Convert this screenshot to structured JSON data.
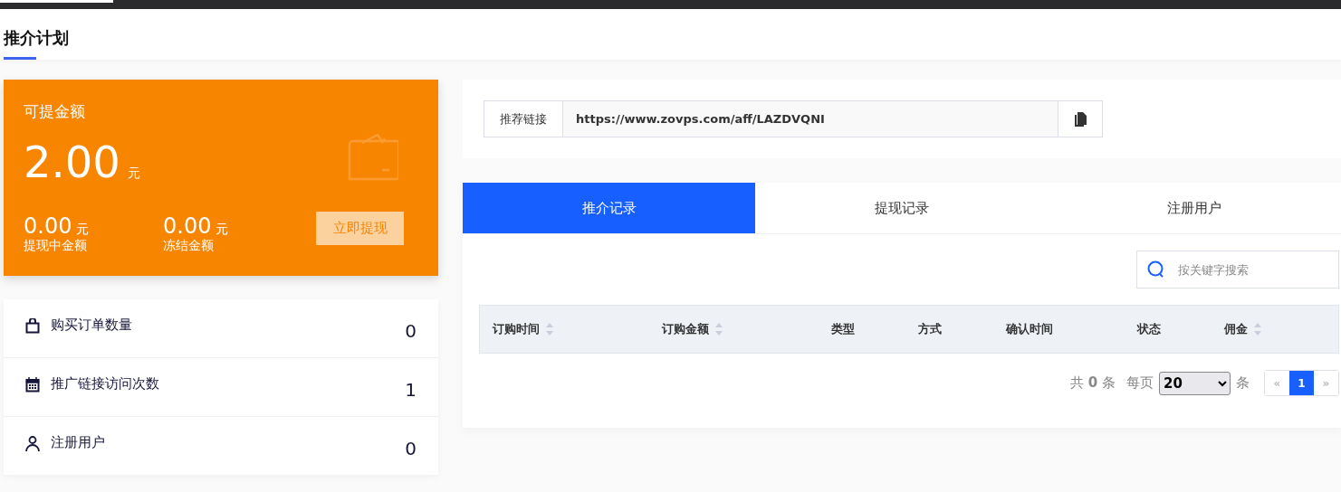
{
  "page_title": "推介计划",
  "balance_card": {
    "label": "可提金额",
    "amount": "2.00",
    "unit": "元",
    "sub_amounts": [
      {
        "amount": "0.00",
        "unit": "元",
        "label": "提现中金额"
      },
      {
        "amount": "0.00",
        "unit": "元",
        "label": "冻结金额"
      }
    ],
    "button": "立即提现"
  },
  "stats": [
    {
      "label": "购买订单数量",
      "value": "0"
    },
    {
      "label": "推广链接访问次数",
      "value": "1"
    },
    {
      "label": "注册用户",
      "value": "0"
    }
  ],
  "referral_link": {
    "label": "推荐链接",
    "value": "https://www.zovps.com/aff/LAZDVQNI"
  },
  "tabs": [
    {
      "label": "推介记录",
      "selected": true
    },
    {
      "label": "提现记录",
      "selected": false
    },
    {
      "label": "注册用户",
      "selected": false
    }
  ],
  "search": {
    "placeholder": "按关键字搜索"
  },
  "table": {
    "columns": [
      {
        "label": "订购时间",
        "sortable": true
      },
      {
        "label": "订购金额",
        "sortable": true
      },
      {
        "label": "类型",
        "sortable": false
      },
      {
        "label": "方式",
        "sortable": false
      },
      {
        "label": "确认时间",
        "sortable": false
      },
      {
        "label": "状态",
        "sortable": false
      },
      {
        "label": "佣金",
        "sortable": true
      }
    ]
  },
  "pagination": {
    "total": "共 **0** 条",
    "per_page_label": "每页",
    "per_page": "20",
    "per_page_unit": "条",
    "pages": [
      {
        "label": "«",
        "selected": false
      },
      {
        "label": "1",
        "selected": true
      },
      {
        "label": "»",
        "selected": false
      }
    ]
  }
}
